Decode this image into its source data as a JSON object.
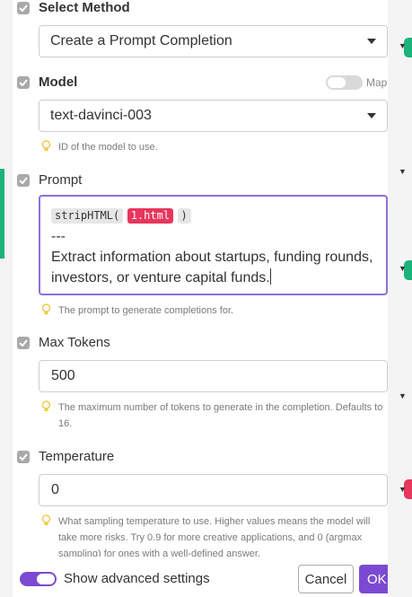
{
  "sections": {
    "method": {
      "label": "Select Method",
      "value": "Create a Prompt Completion"
    },
    "model": {
      "label": "Model",
      "value": "text-davinci-003",
      "hint": "ID of the model to use.",
      "map_label": "Map"
    },
    "prompt": {
      "label": "Prompt",
      "tag_func": "stripHTML(",
      "tag_var": "1.html",
      "tag_close": ")",
      "line_sep": "---",
      "text": "Extract information about startups, funding rounds, investors, or venture capital funds.",
      "hint": "The prompt to generate completions for."
    },
    "max_tokens": {
      "label": "Max Tokens",
      "value": "500",
      "hint": "The maximum number of tokens to generate in the completion. Defaults to 16."
    },
    "temperature": {
      "label": "Temperature",
      "value": "0",
      "hint": "What sampling temperature to use. Higher values means the model will take more risks. Try 0.9 for more creative applications, and 0 (argmax sampling) for ones with a well-defined answer."
    }
  },
  "footer": {
    "advanced_label": "Show advanced settings",
    "advanced_on": true,
    "cancel_label": "Cancel",
    "ok_label": "OK"
  },
  "colors": {
    "accent": "#7b4ad2",
    "focus_border": "#8e6fd8",
    "variable_pill": "#e8365d",
    "node_green": "#1bb37a",
    "hint_bulb": "#f2c744"
  },
  "icons": [
    "checkbox-checked-icon",
    "chevron-down-icon",
    "lightbulb-icon"
  ]
}
